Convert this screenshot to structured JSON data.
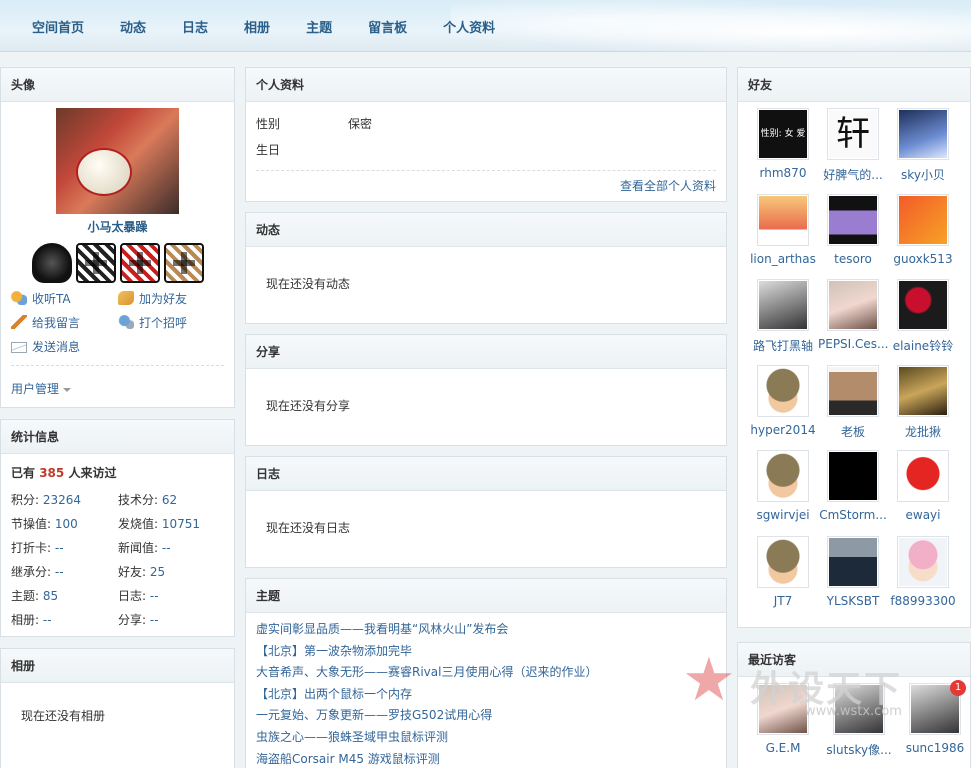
{
  "nav": [
    "空间首页",
    "动态",
    "日志",
    "相册",
    "主题",
    "留言板",
    "个人资料"
  ],
  "avatar_panel": {
    "title": "头像",
    "username": "小马太暴躁",
    "actions": [
      "收听TA",
      "加为好友",
      "给我留言",
      "打个招呼",
      "发送消息"
    ],
    "user_manage": "用户管理"
  },
  "stats_panel": {
    "title": "统计信息",
    "visits_prefix": "已有",
    "visits_count": "385",
    "visits_suffix": "人来访过",
    "items": [
      {
        "label": "积分:",
        "value": "23264"
      },
      {
        "label": "技术分:",
        "value": "62"
      },
      {
        "label": "节操值:",
        "value": "100"
      },
      {
        "label": "发烧值:",
        "value": "10751"
      },
      {
        "label": "打折卡:",
        "value": "--"
      },
      {
        "label": "新闻值:",
        "value": "--"
      },
      {
        "label": "继承分:",
        "value": "--"
      },
      {
        "label": "好友:",
        "value": "25"
      },
      {
        "label": "主题:",
        "value": "85"
      },
      {
        "label": "日志:",
        "value": "--"
      },
      {
        "label": "相册:",
        "value": "--"
      },
      {
        "label": "分享:",
        "value": "--"
      }
    ]
  },
  "album_panel": {
    "title": "相册",
    "empty": "现在还没有相册"
  },
  "profile_panel": {
    "title": "个人资料",
    "rows": [
      {
        "key": "性别",
        "value": "保密"
      },
      {
        "key": "生日",
        "value": ""
      }
    ],
    "view_all": "查看全部个人资料"
  },
  "feed_panel": {
    "title": "动态",
    "empty": "现在还没有动态"
  },
  "share_panel": {
    "title": "分享",
    "empty": "现在还没有分享"
  },
  "blog_panel": {
    "title": "日志",
    "empty": "现在还没有日志"
  },
  "topics_panel": {
    "title": "主题",
    "items": [
      "虚实间彰显品质——我看明基“风林火山”发布会",
      "【北京】第一波杂物添加完毕",
      "大音希声、大象无形——赛睿Rival三月使用心得（迟来的作业）",
      "【北京】出两个鼠标一个内存",
      "一元复始、万象更新——罗技G502试用心得",
      "虫族之心——狼蛛圣域甲虫鼠标评测",
      "海盗船Corsair M45 游戏鼠标评测"
    ]
  },
  "friends_panel": {
    "title": "好友",
    "items": [
      {
        "name": "rhm870",
        "pic": "p-dark",
        "glyph": "性别: 女 爱好: 男"
      },
      {
        "name": "好脾气的...",
        "pic": "p-ink",
        "glyph": "轩"
      },
      {
        "name": "sky小贝",
        "pic": "p-sky",
        "glyph": ""
      },
      {
        "name": "lion_arthas",
        "pic": "p-cartoon",
        "glyph": ""
      },
      {
        "name": "tesoro",
        "pic": "p-mask",
        "glyph": ""
      },
      {
        "name": "guoxk513",
        "pic": "p-love",
        "glyph": ""
      },
      {
        "name": "路飞打黑轴",
        "pic": "p-face",
        "glyph": ""
      },
      {
        "name": "PEPSI.Ces...",
        "pic": "p-girl",
        "glyph": ""
      },
      {
        "name": "elaine铃铃",
        "pic": "p-rose",
        "glyph": ""
      },
      {
        "name": "hyper2014",
        "pic": "p-soldier",
        "glyph": ""
      },
      {
        "name": "老板",
        "pic": "p-man",
        "glyph": ""
      },
      {
        "name": "龙批揪",
        "pic": "p-mona",
        "glyph": ""
      },
      {
        "name": "sgwirvjei",
        "pic": "p-soldier",
        "glyph": ""
      },
      {
        "name": "CmStorm...",
        "pic": "p-cm",
        "glyph": ""
      },
      {
        "name": "ewayi",
        "pic": "p-mario",
        "glyph": ""
      },
      {
        "name": "JT7",
        "pic": "p-soldier",
        "glyph": ""
      },
      {
        "name": "YLSKSBT",
        "pic": "p-suit",
        "glyph": ""
      },
      {
        "name": "f88993300",
        "pic": "p-anime",
        "glyph": ""
      }
    ]
  },
  "visitors_panel": {
    "title": "最近访客",
    "items": [
      {
        "name": "G.E.M",
        "pic": "p-girl",
        "badge": ""
      },
      {
        "name": "slutsky像...",
        "pic": "p-face",
        "badge": ""
      },
      {
        "name": "sunc1986",
        "pic": "p-face",
        "badge": "1"
      }
    ]
  },
  "watermark": {
    "text": "外设天下",
    "url": "www.wstx.com"
  }
}
